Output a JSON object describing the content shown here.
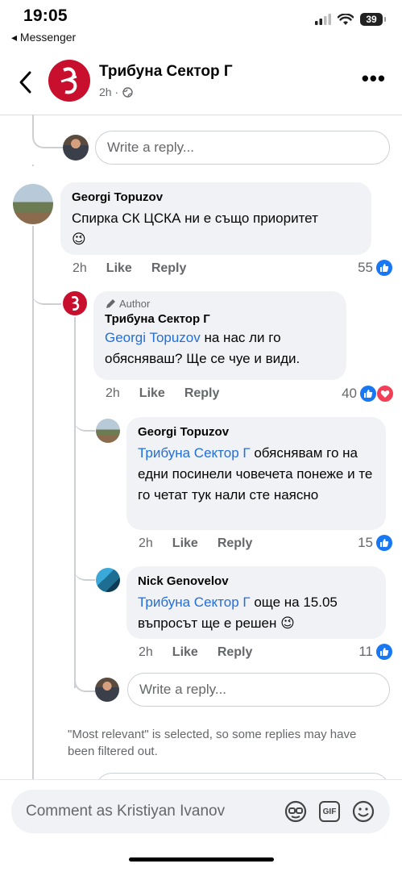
{
  "status_bar": {
    "time": "19:05",
    "back_app": "◂ Messenger",
    "battery": "39"
  },
  "header": {
    "title": "Трибуна Сектор Г",
    "time": "2h ·"
  },
  "reply_placeholder": "Write a reply...",
  "comments": [
    {
      "author": "Georgi Topuzov",
      "text": "Спирка СК ЦСКА ни е също приоритет",
      "emoji": "😉",
      "time": "2h",
      "like": "Like",
      "reply": "Reply",
      "reactions": "55"
    },
    {
      "author_tag": "Author",
      "author": "Трибуна Сектор Г",
      "mention": "Georgi Topuzov",
      "text": " на нас ли го обясняваш?  Ще се чуе и види.",
      "time": "2h",
      "like": "Like",
      "reply": "Reply",
      "reactions": "40"
    },
    {
      "author": "Georgi Topuzov",
      "mention": "Трибуна Сектор Г",
      "text": " обяснявам го на едни посинели човечета понеже и те го четат тук нали сте наясно",
      "time": "2h",
      "like": "Like",
      "reply": "Reply",
      "reactions": "15"
    },
    {
      "author": "Nick Genovelov",
      "mention": "Трибуна Сектор Г",
      "text": " още на 15.05 въпросът ще е решен",
      "emoji": "😉",
      "time": "2h",
      "like": "Like",
      "reply": "Reply",
      "reactions": "11"
    }
  ],
  "notice": "\"Most relevant\" is selected, so some replies may have been filtered out.",
  "composer": {
    "placeholder": "Comment as Kristiyan Ivanov",
    "gif_label": "GIF"
  },
  "colors": {
    "like": "#1877f2",
    "love": "#f33e58",
    "mention": "#216fdb",
    "bubble": "#f0f2f5",
    "brand": "#c8102e"
  }
}
